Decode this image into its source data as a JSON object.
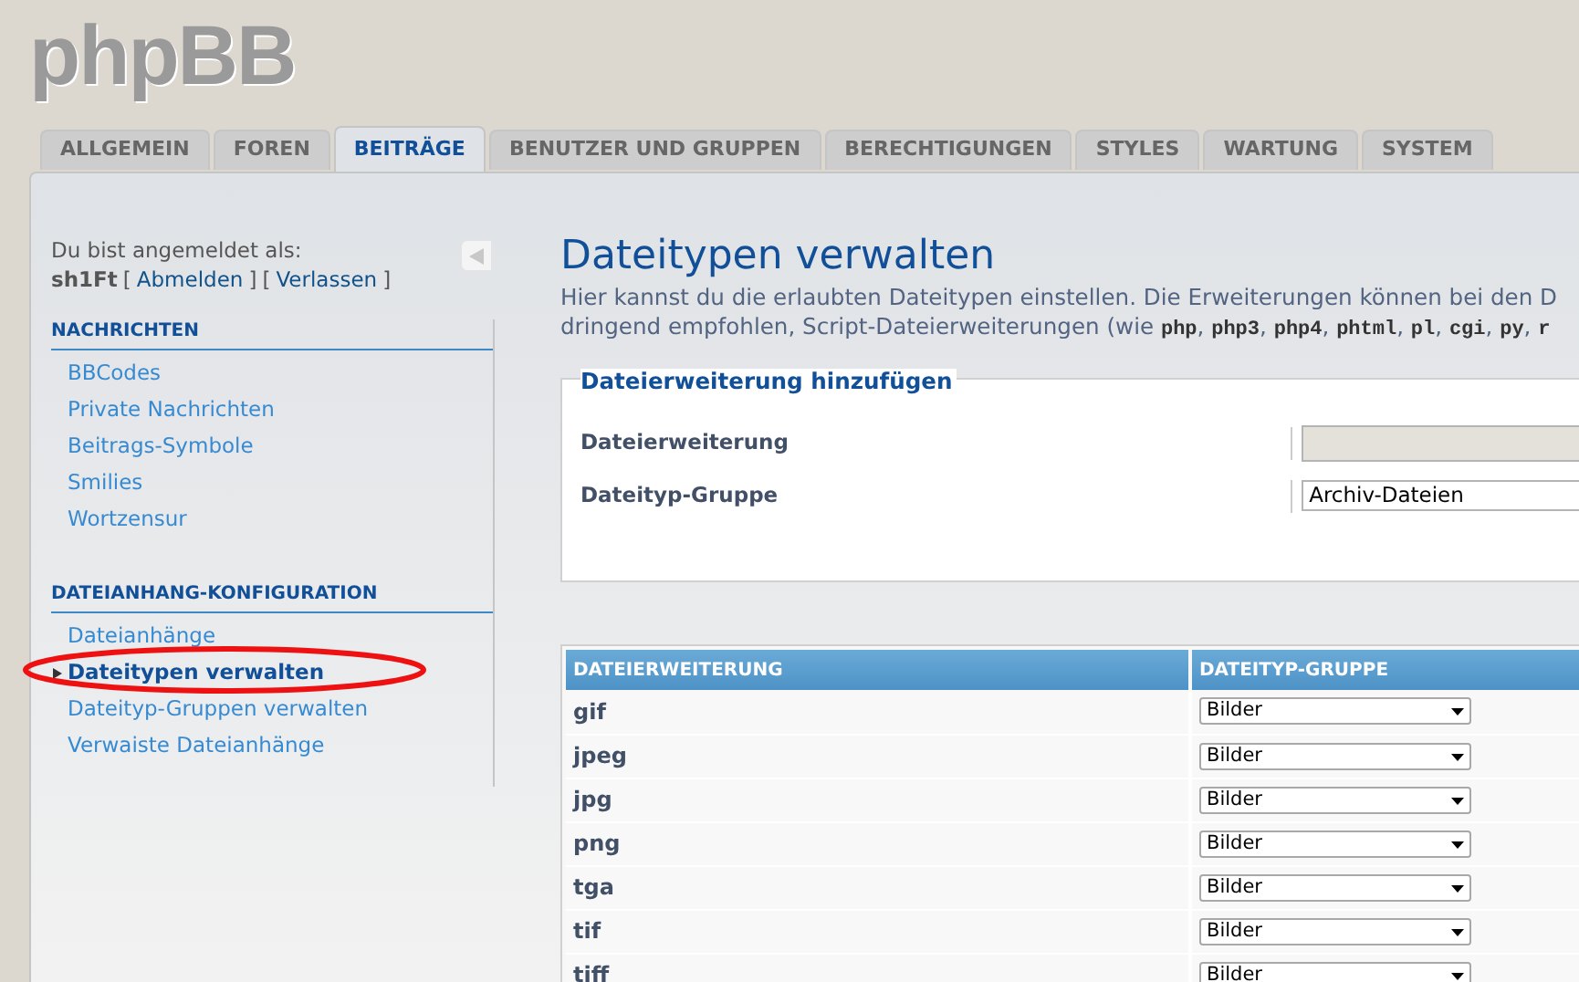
{
  "logo": "phpBB",
  "tabs": [
    {
      "label": "ALLGEMEIN",
      "selected": false
    },
    {
      "label": "FOREN",
      "selected": false
    },
    {
      "label": "BEITRÄGE",
      "selected": true
    },
    {
      "label": "BENUTZER UND GRUPPEN",
      "selected": false
    },
    {
      "label": "BERECHTIGUNGEN",
      "selected": false
    },
    {
      "label": "STYLES",
      "selected": false
    },
    {
      "label": "WARTUNG",
      "selected": false
    },
    {
      "label": "SYSTEM",
      "selected": false
    }
  ],
  "sidebar": {
    "login_label": "Du bist angemeldet als:",
    "username": "sh1Ft",
    "links": [
      {
        "bracket_open": "[",
        "label": "Abmelden",
        "bracket_close": "]"
      },
      {
        "bracket_open": "[",
        "label": "Verlassen",
        "bracket_close": "]"
      }
    ],
    "sections": [
      {
        "title": "NACHRICHTEN",
        "items": [
          {
            "label": "BBCodes",
            "selected": false
          },
          {
            "label": "Private Nachrichten",
            "selected": false
          },
          {
            "label": "Beitrags-Symbole",
            "selected": false
          },
          {
            "label": "Smilies",
            "selected": false
          },
          {
            "label": "Wortzensur",
            "selected": false
          }
        ]
      },
      {
        "title": "DATEIANHANG-KONFIGURATION",
        "items": [
          {
            "label": "Dateianhänge",
            "selected": false
          },
          {
            "label": "Dateitypen verwalten",
            "selected": true
          },
          {
            "label": "Dateityp-Gruppen verwalten",
            "selected": false
          },
          {
            "label": "Verwaiste Dateianhänge",
            "selected": false
          }
        ]
      }
    ]
  },
  "page": {
    "title": "Dateitypen verwalten",
    "description": [
      [
        {
          "kind": "text",
          "text": "Hier kannst du die erlaubten Dateitypen einstellen. Die Erweiterungen können bei den D"
        }
      ],
      [
        {
          "kind": "text",
          "text": "dringend empfohlen, Script-Dateierweiterungen (wie "
        },
        {
          "kind": "code",
          "text": "php"
        },
        {
          "kind": "text",
          "text": ", "
        },
        {
          "kind": "code",
          "text": "php3"
        },
        {
          "kind": "text",
          "text": ", "
        },
        {
          "kind": "code",
          "text": "php4"
        },
        {
          "kind": "text",
          "text": ", "
        },
        {
          "kind": "code",
          "text": "phtml"
        },
        {
          "kind": "text",
          "text": ", "
        },
        {
          "kind": "code",
          "text": "pl"
        },
        {
          "kind": "text",
          "text": ", "
        },
        {
          "kind": "code",
          "text": "cgi"
        },
        {
          "kind": "text",
          "text": ", "
        },
        {
          "kind": "code",
          "text": "py"
        },
        {
          "kind": "text",
          "text": ", "
        },
        {
          "kind": "code",
          "text": "r"
        }
      ]
    ]
  },
  "add_form": {
    "legend": "Dateierweiterung hinzufügen",
    "fields": [
      {
        "label": "Dateierweiterung",
        "kind": "input"
      },
      {
        "label": "Dateityp-Gruppe",
        "kind": "select",
        "value": "Archiv-Dateien"
      }
    ]
  },
  "table": {
    "columns": [
      "DATEIERWEITERUNG",
      "DATEITYP-GRUPPE"
    ],
    "rows": [
      {
        "extension": "gif",
        "group": "Bilder"
      },
      {
        "extension": "jpeg",
        "group": "Bilder"
      },
      {
        "extension": "jpg",
        "group": "Bilder"
      },
      {
        "extension": "png",
        "group": "Bilder"
      },
      {
        "extension": "tga",
        "group": "Bilder"
      },
      {
        "extension": "tif",
        "group": "Bilder"
      },
      {
        "extension": "tiff",
        "group": "Bilder"
      }
    ]
  }
}
